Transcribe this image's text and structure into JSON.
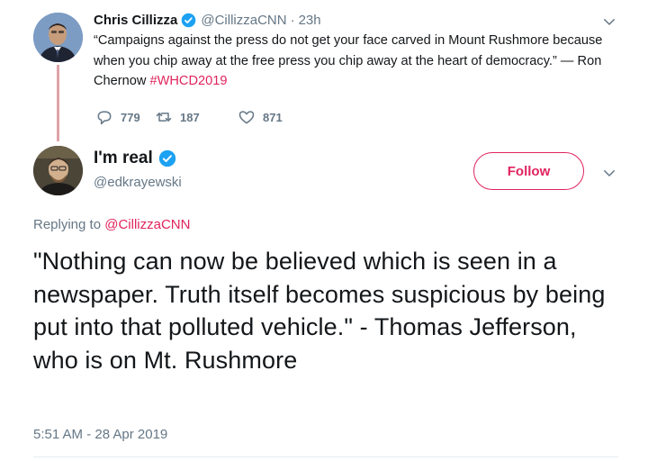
{
  "parent_tweet": {
    "author_name": "Chris Cillizza",
    "handle": "@CillizzaCNN",
    "separator": "·",
    "time": "23h",
    "text_body": "“Campaigns against the press do not get your face carved in Mount Rushmore because when you chip away at the free press you chip away at the heart of democracy.” — Ron Chernow ",
    "hashtag": "#WHCD2019",
    "reply_count": "779",
    "retweet_count": "187",
    "like_count": "871"
  },
  "main_tweet": {
    "author_name": "I'm real",
    "handle": "@edkrayewski",
    "follow_label": "Follow",
    "replying_prefix": "Replying to ",
    "replying_to": "@CillizzaCNN",
    "text": "\"Nothing can now be believed which is seen in a newspaper. Truth itself becomes suspicious by being put into that polluted vehicle.\" - Thomas Jefferson, who is on Mt. Rushmore",
    "timestamp": "5:51 AM - 28 Apr 2019"
  },
  "icons": [
    "verified-badge-icon",
    "chevron-down-icon",
    "reply-icon",
    "retweet-icon",
    "like-icon"
  ],
  "colors": {
    "accent": "#e0245e",
    "verified": "#1da1f2",
    "secondary_text": "#657786",
    "thread_line": "#e0a3a8"
  }
}
